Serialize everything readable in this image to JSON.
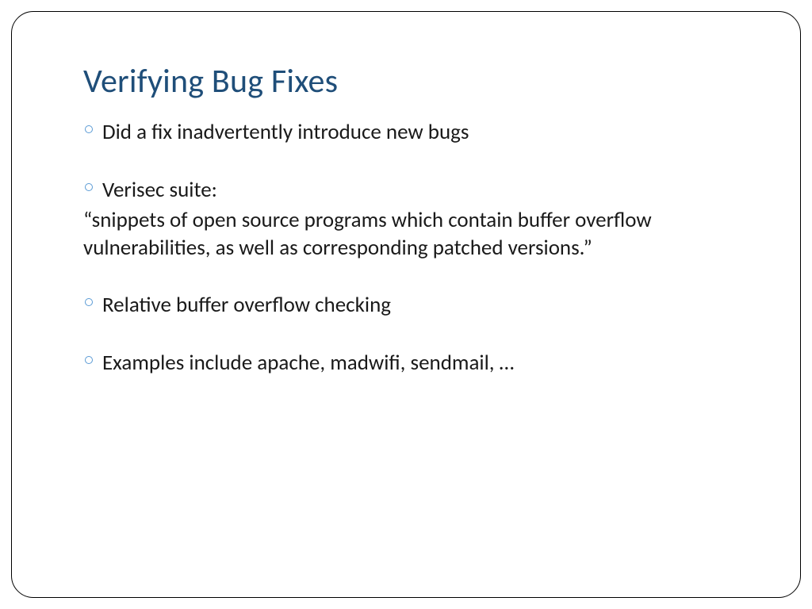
{
  "slide": {
    "title": "Verifying Bug Fixes",
    "items": [
      {
        "type": "bullet",
        "text": "Did a fix inadvertently introduce new bugs"
      },
      {
        "type": "spacer"
      },
      {
        "type": "bullet",
        "text": "Verisec suite:"
      },
      {
        "type": "paragraph",
        "text": "“snippets of open source programs which contain buffer overflow vulnerabilities, as well as corresponding patched versions.”"
      },
      {
        "type": "spacer"
      },
      {
        "type": "bullet",
        "text": "Relative buffer overflow checking"
      },
      {
        "type": "spacer"
      },
      {
        "type": "bullet",
        "text": "Examples include apache, madwifi, sendmail, …"
      }
    ]
  }
}
